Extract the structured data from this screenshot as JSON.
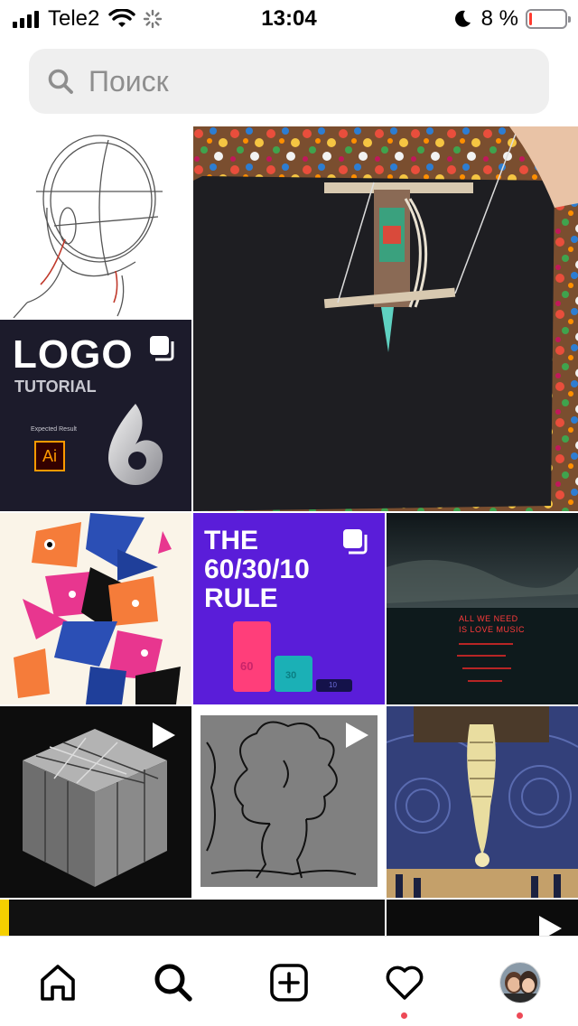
{
  "status_bar": {
    "carrier": "Tele2",
    "time": "13:04",
    "battery_percent": "8 %",
    "battery_level": 0.08
  },
  "search": {
    "placeholder": "Поиск",
    "icon": "search-icon"
  },
  "tiles": {
    "logo_tutorial": {
      "title": "LOGO",
      "subtitle": "TUTORIAL",
      "caption": "Expected Result",
      "app_badge": "Ai"
    },
    "rule_603010": {
      "line1": "THE",
      "line2": "60/30/10",
      "line3": "RULE",
      "bar_labels": [
        "60",
        "30",
        "10"
      ]
    },
    "neon_sea": {
      "line1": "ALL WE NEED",
      "line2": "IS LOVE MUSIC"
    }
  },
  "bottom_nav": {
    "items": [
      "home-icon",
      "search-icon",
      "add-post-icon",
      "heart-icon",
      "profile-avatar"
    ],
    "accent": "#ed4956"
  },
  "colors": {
    "search_bg": "#efefef",
    "notification_dot": "#ed4956",
    "battery_low": "#ff3b30"
  }
}
